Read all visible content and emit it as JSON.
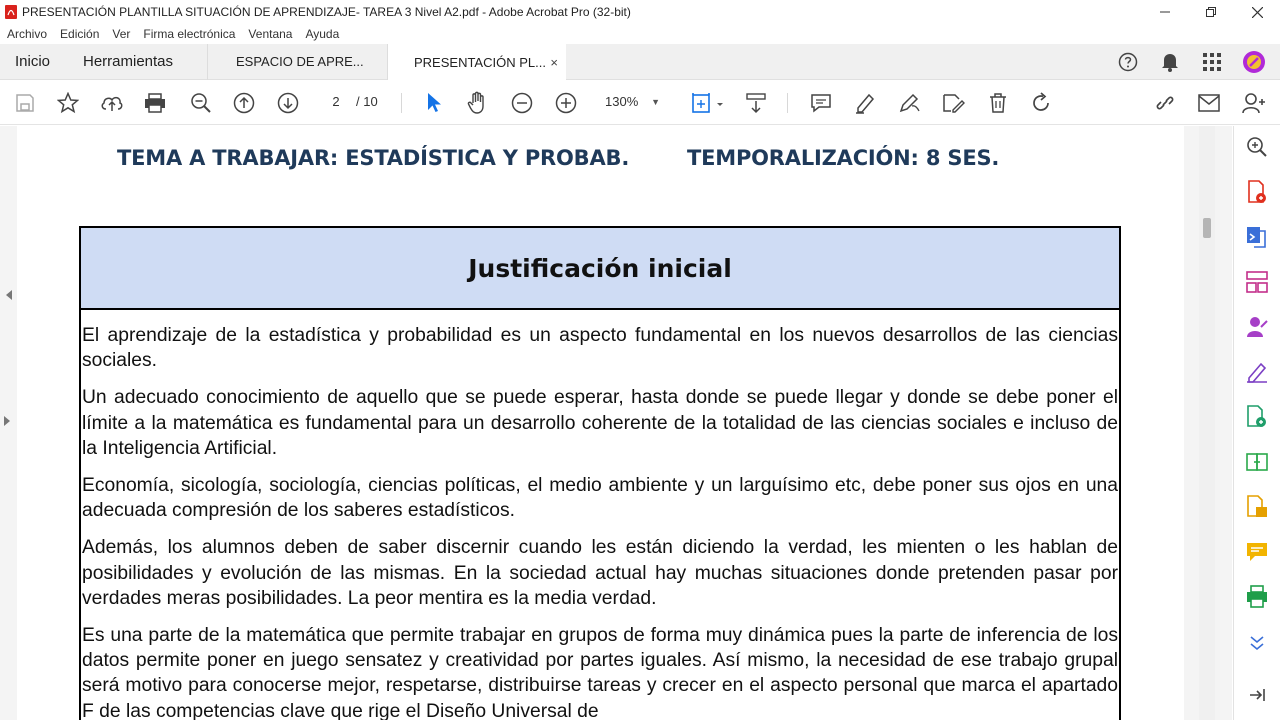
{
  "window": {
    "title": "PRESENTACIÓN PLANTILLA SITUACIÓN DE APRENDIZAJE- TAREA 3 Nivel A2.pdf - Adobe Acrobat Pro (32-bit)"
  },
  "menu": [
    "Archivo",
    "Edición",
    "Ver",
    "Firma electrónica",
    "Ventana",
    "Ayuda"
  ],
  "tabs": {
    "home": "Inicio",
    "tools": "Herramientas",
    "doc1": "ESPACIO DE APRE...",
    "doc2": "PRESENTACIÓN PL...",
    "close": "×"
  },
  "toolbar": {
    "page_current": "2",
    "page_total": "/ 10",
    "zoom": "130%"
  },
  "document": {
    "topic": "TEMA A TRABAJAR: ESTADÍSTICA Y PROBAB.",
    "timing": "TEMPORALIZACIÓN: 8 SES.",
    "section_title": "Justificación inicial",
    "paragraphs": [
      "El aprendizaje de la estadística y probabilidad es un aspecto fundamental en los nuevos desarrollos de las ciencias sociales.",
      "Un adecuado conocimiento de aquello que se puede esperar, hasta donde se puede llegar y donde se debe poner el límite a la matemática es fundamental para un desarrollo coherente de la totalidad de las ciencias sociales e incluso de la Inteligencia Artificial.",
      "Economía, sicología, sociología, ciencias políticas, el medio ambiente y un larguísimo etc, debe poner sus ojos en una adecuada compresión de los saberes estadísticos.",
      "Además, los alumnos deben de saber discernir cuando les están diciendo la verdad, les mienten o les hablan de posibilidades y evolución de las mismas. En la sociedad actual hay muchas situaciones donde pretenden pasar por verdades meras posibilidades. La peor mentira es la media verdad.",
      "Es una parte de la matemática que permite trabajar en grupos de forma muy dinámica pues la parte de inferencia de los datos permite poner en juego sensatez y creatividad por partes iguales. Así mismo, la necesidad de ese trabajo grupal será motivo para conocerse mejor, respetarse, distribuirse tareas y crecer en el aspecto personal que marca el apartado F de las competencias clave que rige el Diseño Universal de"
    ]
  },
  "colors": {
    "heading_blue": "#1f3a5a",
    "box_header_bg": "#cfdcf4",
    "acrobat_red": "#d9231d",
    "selected_tool_blue": "#1473e6"
  }
}
